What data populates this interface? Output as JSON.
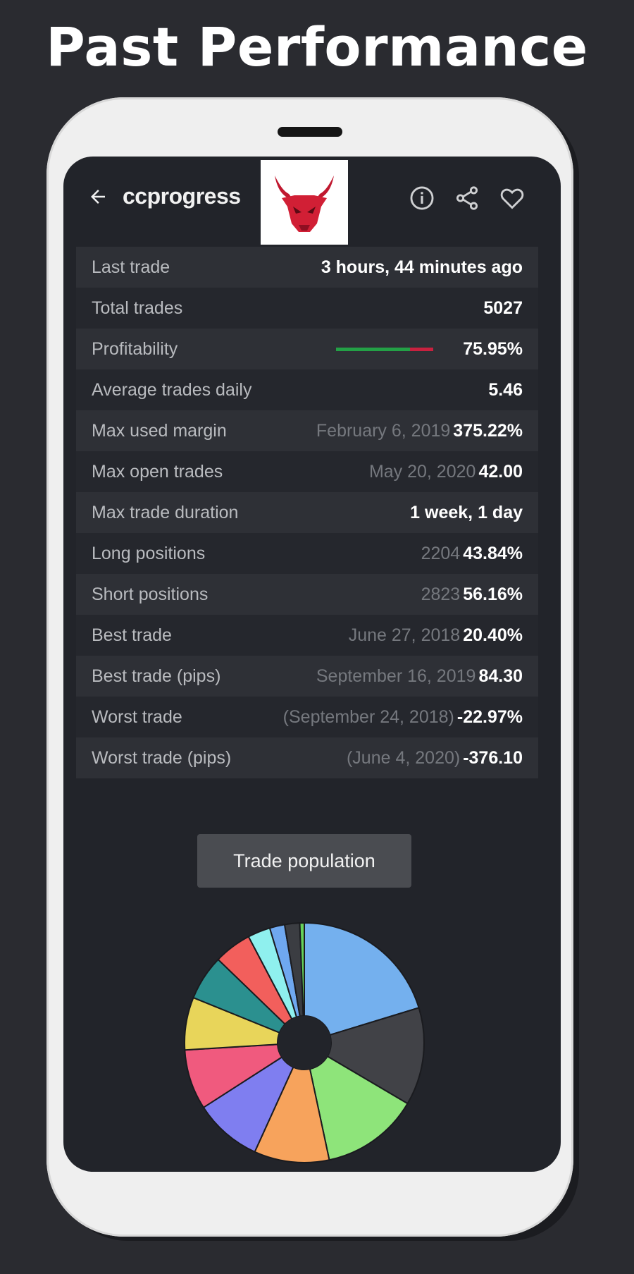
{
  "headline": "Past Performance",
  "appbar": {
    "title": "ccprogress",
    "back_icon": "arrow-left-icon",
    "actions": [
      "info-icon",
      "share-icon",
      "heart-icon"
    ],
    "logo": "bull-logo"
  },
  "stats": [
    {
      "label": "Last trade",
      "sub": "",
      "value": "3 hours, 44 minutes ago"
    },
    {
      "label": "Total trades",
      "sub": "",
      "value": "5027"
    },
    {
      "label": "Profitability",
      "sub": "",
      "value": "75.95%",
      "bar_fraction": 0.7595
    },
    {
      "label": "Average trades daily",
      "sub": "",
      "value": "5.46"
    },
    {
      "label": "Max used margin",
      "sub": "February 6, 2019",
      "value": "375.22%"
    },
    {
      "label": "Max open trades",
      "sub": "May 20, 2020",
      "value": "42.00"
    },
    {
      "label": "Max trade duration",
      "sub": "",
      "value": "1 week, 1 day"
    },
    {
      "label": "Long positions",
      "sub": "2204",
      "value": "43.84%"
    },
    {
      "label": "Short positions",
      "sub": "2823",
      "value": "56.16%"
    },
    {
      "label": "Best trade",
      "sub": "June 27, 2018",
      "value": "20.40%"
    },
    {
      "label": "Best trade (pips)",
      "sub": "September 16, 2019",
      "value": "84.30"
    },
    {
      "label": "Worst trade",
      "sub": "(September 24, 2018)",
      "value": "-22.97%"
    },
    {
      "label": "Worst trade (pips)",
      "sub": "(June 4, 2020)",
      "value": "-376.10"
    }
  ],
  "button": {
    "label": "Trade population"
  },
  "colors": {
    "profit_green": "#23a046",
    "loss_red": "#c8213f",
    "pie": [
      "#74b0ee",
      "#414247",
      "#8ee47a",
      "#f7a35c",
      "#7f7ef0",
      "#f05a7e",
      "#e8d55a",
      "#2b908f",
      "#f25f5c",
      "#8ff0ee",
      "#6fa8f0",
      "#3b3d42",
      "#66d35a"
    ]
  },
  "chart_data": {
    "type": "pie",
    "donut": true,
    "values": [
      20,
      13,
      13,
      10,
      9,
      8,
      7,
      6,
      5,
      3,
      2,
      2,
      0.6
    ]
  }
}
